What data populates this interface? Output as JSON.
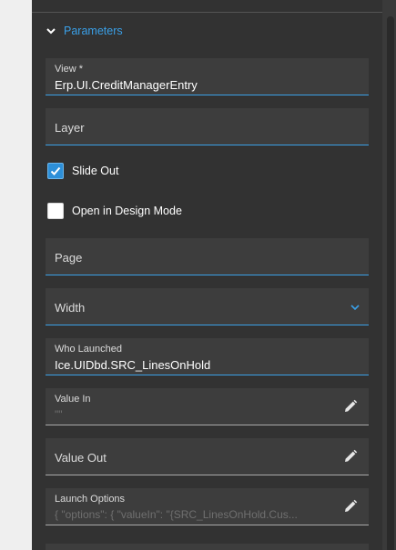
{
  "section": {
    "title": "Parameters"
  },
  "fields": {
    "view": {
      "label": "View *",
      "value": "Erp.UI.CreditManagerEntry"
    },
    "layer": {
      "label": "Layer"
    },
    "page": {
      "label": "Page"
    },
    "width": {
      "label": "Width"
    },
    "who_launched": {
      "label": "Who Launched",
      "value": "Ice.UIDbd.SRC_LinesOnHold"
    },
    "value_in": {
      "label": "Value In",
      "placeholder": "\"\""
    },
    "value_out": {
      "label": "Value Out"
    },
    "launch_options": {
      "label": "Launch Options",
      "placeholder": "{  \"options\": {    \"valueIn\": \"{SRC_LinesOnHold.Cus..."
    }
  },
  "checkboxes": {
    "slide_out": {
      "label": "Slide Out",
      "checked": true
    },
    "open_in_design_mode": {
      "label": "Open in Design Mode",
      "checked": false
    }
  },
  "icons": {
    "section_toggle": "chevron-down-icon",
    "edit": "pencil-icon",
    "dropdown": "chevron-down-icon",
    "check": "checkmark-icon"
  },
  "colors": {
    "accent": "#3aa0e8",
    "panel_bg": "#323232",
    "field_bg": "#3d3d3d",
    "checkbox_on": "#2d8fd8"
  }
}
